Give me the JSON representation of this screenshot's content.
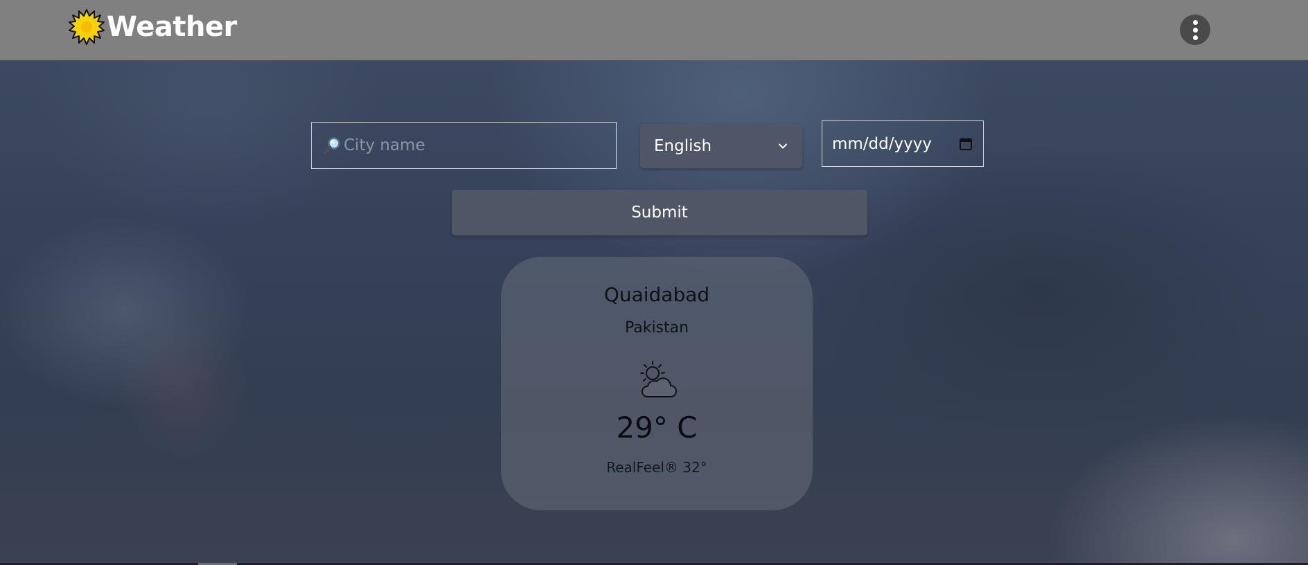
{
  "header": {
    "title": "Weather",
    "logo_icon": "sun-icon",
    "menu_icon": "more-vertical-icon"
  },
  "search": {
    "placeholder": "City name",
    "value": "",
    "icon": "search-icon"
  },
  "language": {
    "selected": "English",
    "icon": "chevron-down-icon"
  },
  "date": {
    "value": "mm/dd/yyyy",
    "icon": "calendar-icon"
  },
  "submit": {
    "label": "Submit"
  },
  "weather": {
    "city": "Quaidabad",
    "country": "Pakistan",
    "condition_icon": "partly-cloudy-icon",
    "temperature": "29° C",
    "realfeel": "RealFeel® 32°"
  },
  "colors": {
    "header_bg": "#808080",
    "brand_sun": "#f5d20a",
    "control_bg": "#4e5667",
    "card_bg": "#6c7280"
  }
}
